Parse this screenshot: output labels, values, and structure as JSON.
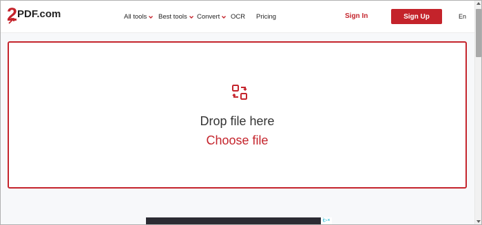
{
  "logo": {
    "number": "2",
    "text": "PDF.com"
  },
  "nav": {
    "items": [
      {
        "label": "All tools",
        "has_dropdown": true
      },
      {
        "label": "Best tools",
        "has_dropdown": true
      },
      {
        "label": "Convert",
        "has_dropdown": true
      },
      {
        "label": "OCR",
        "has_dropdown": false
      },
      {
        "label": "Pricing",
        "has_dropdown": false
      }
    ]
  },
  "header": {
    "sign_in": "Sign In",
    "sign_up": "Sign Up",
    "language": "En"
  },
  "dropzone": {
    "icon": "convert-arrows-icon",
    "prompt": "Drop file here",
    "choose_label": "Choose file"
  },
  "ad": {
    "badge": "i▷×"
  },
  "colors": {
    "brand": "#c4232b",
    "text": "#333333",
    "background": "#f7f8fa"
  }
}
